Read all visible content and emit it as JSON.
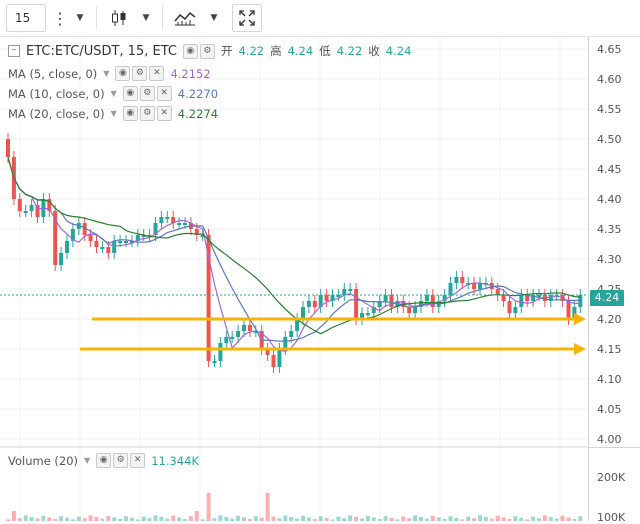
{
  "toolbar": {
    "interval": "15",
    "icons": [
      "more-vert-icon",
      "dropdown-icon",
      "candles-icon",
      "dropdown-icon",
      "indicators-icon",
      "dropdown-icon",
      "fullscreen-icon"
    ]
  },
  "legend": {
    "symbol": "ETC:ETC/USDT, 15, ETC",
    "open_label": "开",
    "open": "4.22",
    "high_label": "高",
    "high": "4.24",
    "low_label": "低",
    "low": "4.22",
    "close_label": "收",
    "close": "4.24",
    "ma": [
      {
        "label": "MA (5, close, 0)",
        "value": "4.2152",
        "color": "#9c6bd6"
      },
      {
        "label": "MA (10, close, 0)",
        "value": "4.2270",
        "color": "#5b78b8"
      },
      {
        "label": "MA (20, close, 0)",
        "value": "4.2274",
        "color": "#2e7d32"
      }
    ],
    "volume_label": "Volume (20)",
    "volume_value": "11.344K"
  },
  "price_axis": {
    "ticks": [
      "4.65",
      "4.60",
      "4.55",
      "4.50",
      "4.45",
      "4.40",
      "4.35",
      "4.30",
      "4.25",
      "4.20",
      "4.15",
      "4.10",
      "4.05",
      "4.00"
    ],
    "current": "4.24",
    "volume_ticks": [
      "200K",
      "100K"
    ]
  },
  "colors": {
    "up": "#26a69a",
    "down": "#ef5350",
    "arrow": "#f5b400",
    "grid": "#f0f0f0"
  },
  "chart_data": {
    "type": "candlestick",
    "ylim": [
      3.98,
      4.67
    ],
    "current_price": 4.24,
    "horizontal_lines": [
      4.2,
      4.15
    ],
    "close": [
      4.47,
      4.4,
      4.38,
      4.38,
      4.39,
      4.37,
      4.4,
      4.38,
      4.29,
      4.31,
      4.33,
      4.35,
      4.36,
      4.34,
      4.33,
      4.32,
      4.32,
      4.31,
      4.33,
      4.33,
      4.33,
      4.33,
      4.34,
      4.34,
      4.34,
      4.36,
      4.37,
      4.37,
      4.36,
      4.36,
      4.36,
      4.35,
      4.34,
      4.34,
      4.13,
      4.13,
      4.16,
      4.17,
      4.17,
      4.18,
      4.19,
      4.18,
      4.18,
      4.15,
      4.14,
      4.12,
      4.15,
      4.17,
      4.18,
      4.2,
      4.22,
      4.23,
      4.22,
      4.24,
      4.23,
      4.24,
      4.24,
      4.25,
      4.25,
      4.2,
      4.21,
      4.21,
      4.22,
      4.23,
      4.24,
      4.22,
      4.23,
      4.22,
      4.21,
      4.22,
      4.23,
      4.24,
      4.22,
      4.23,
      4.24,
      4.26,
      4.27,
      4.26,
      4.26,
      4.25,
      4.26,
      4.26,
      4.25,
      4.24,
      4.23,
      4.21,
      4.22,
      4.24,
      4.23,
      4.24,
      4.24,
      4.23,
      4.24,
      4.24,
      4.23,
      4.2,
      4.22,
      4.24
    ],
    "ma_periods": [
      5,
      10,
      20
    ]
  }
}
